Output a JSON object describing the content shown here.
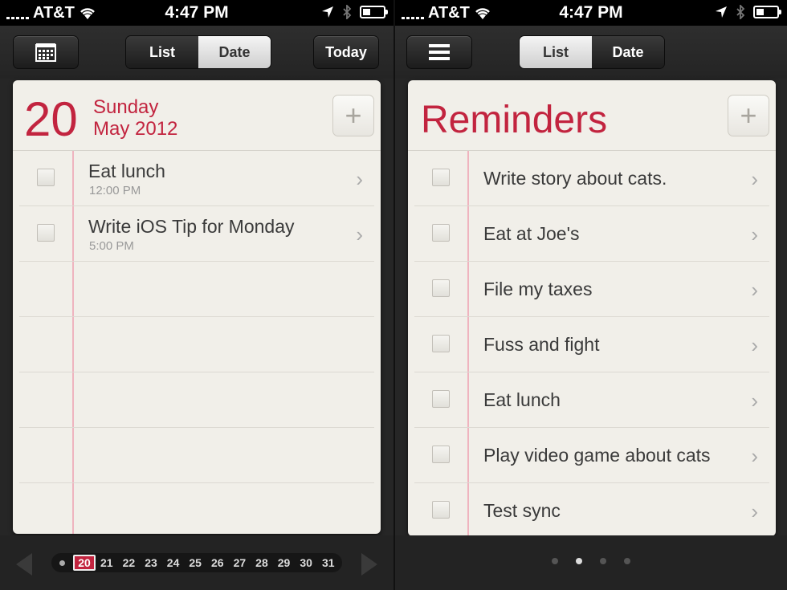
{
  "status": {
    "carrier": "AT&T",
    "time": "4:47 PM"
  },
  "left": {
    "toolbar": {
      "list_tab": "List",
      "date_tab": "Date",
      "today_button": "Today"
    },
    "header": {
      "day_number": "20",
      "weekday": "Sunday",
      "month_year": "May 2012",
      "add_label": "+"
    },
    "items": [
      {
        "title": "Eat lunch",
        "time": "12:00 PM"
      },
      {
        "title": "Write iOS Tip for Monday",
        "time": "5:00 PM"
      }
    ],
    "date_strip": {
      "selected": "20",
      "days": [
        "20",
        "21",
        "22",
        "23",
        "24",
        "25",
        "26",
        "27",
        "28",
        "29",
        "30",
        "31"
      ]
    }
  },
  "right": {
    "toolbar": {
      "list_tab": "List",
      "date_tab": "Date"
    },
    "header": {
      "title": "Reminders",
      "add_label": "+"
    },
    "items": [
      {
        "title": "Write story about cats."
      },
      {
        "title": "Eat at Joe's"
      },
      {
        "title": "File my taxes"
      },
      {
        "title": "Fuss and fight"
      },
      {
        "title": "Eat lunch"
      },
      {
        "title": "Play video game about cats"
      },
      {
        "title": "Test sync"
      }
    ],
    "pager": {
      "pages": 4,
      "active_index": 1
    }
  },
  "colors": {
    "accent": "#c2243f",
    "paper": "#f1efe9",
    "chrome": "#262626"
  }
}
